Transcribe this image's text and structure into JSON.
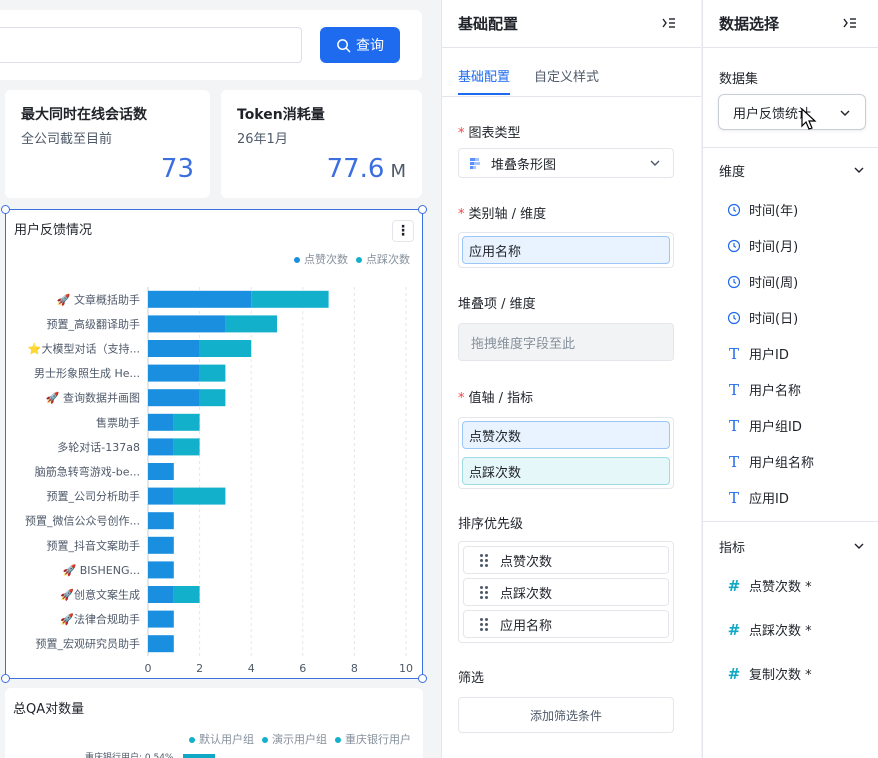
{
  "query": {
    "button_label": "查询",
    "input_value": ""
  },
  "metrics": [
    {
      "title": "最大同时在线会话数",
      "subtitle": "全公司截至目前",
      "value": "73",
      "unit": ""
    },
    {
      "title": "Token消耗量",
      "subtitle": "26年1月",
      "value": "77.6",
      "unit": "M"
    }
  ],
  "feedback_chart": {
    "title": "用户反馈情况",
    "more": "⋮",
    "legend": [
      "点赞次数",
      "点踩次数"
    ]
  },
  "chart_data": {
    "type": "bar",
    "orientation": "horizontal",
    "stacked": true,
    "categories": [
      "🚀 文章概括助手",
      "预置_高级翻译助手",
      "⭐大模型对话（支持...",
      "男士形象照生成 He...",
      "🚀 查询数据并画图",
      "售票助手",
      "多轮对话-137a8",
      "脑筋急转弯游戏-be...",
      "预置_公司分析助手",
      "预置_微信公众号创作...",
      "预置_抖音文案助手",
      "🚀 BISHENG...",
      "🚀创意文案生成",
      "🚀法律合规助手",
      "预置_宏观研究员助手"
    ],
    "series": [
      {
        "name": "点赞次数",
        "color": "#1a8fe0",
        "values": [
          4,
          3,
          2,
          2,
          2,
          1,
          1,
          1,
          1,
          1,
          1,
          1,
          1,
          1,
          1
        ]
      },
      {
        "name": "点踩次数",
        "color": "#13b0cc",
        "values": [
          3,
          2,
          2,
          1,
          1,
          1,
          1,
          0,
          2,
          0,
          0,
          0,
          1,
          0,
          0
        ]
      }
    ],
    "xlim": [
      0,
      10
    ],
    "xticks": [
      0,
      2,
      4,
      6,
      8,
      10
    ],
    "grid": true,
    "legend_position": "top-right"
  },
  "qa_chart": {
    "title": "总QA对数量",
    "legend": [
      {
        "label": "默认用户组",
        "color": "#13b0cc"
      },
      {
        "label": "演示用户组",
        "color": "#13b0cc"
      },
      {
        "label": "重庆银行用户",
        "color": "#13b0cc"
      }
    ],
    "peek_label": "重庆银行用户: 0.54%"
  },
  "config_panel": {
    "title": "基础配置",
    "tabs": [
      "基础配置",
      "自定义样式"
    ],
    "chart_type_label": "图表类型",
    "chart_type_value": "堆叠条形图",
    "category_axis_label": "类别轴 / 维度",
    "category_axis_value": "应用名称",
    "stack_label": "堆叠项 / 维度",
    "stack_placeholder": "拖拽维度字段至此",
    "value_axis_label": "值轴 / 指标",
    "value_axis_items": [
      "点赞次数",
      "点踩次数"
    ],
    "sort_label": "排序优先级",
    "sort_items": [
      "点赞次数",
      "点踩次数",
      "应用名称"
    ],
    "filter_label": "筛选",
    "add_filter": "添加筛选条件"
  },
  "data_panel": {
    "title": "数据选择",
    "dataset_label": "数据集",
    "dataset_value": "用户反馈统计",
    "dimension_label": "维度",
    "dimensions": [
      {
        "label": "时间(年)",
        "icon": "clock-icon"
      },
      {
        "label": "时间(月)",
        "icon": "clock-icon"
      },
      {
        "label": "时间(周)",
        "icon": "clock-icon"
      },
      {
        "label": "时间(日)",
        "icon": "clock-icon"
      },
      {
        "label": "用户ID",
        "icon": "text-type-icon"
      },
      {
        "label": "用户名称",
        "icon": "text-type-icon"
      },
      {
        "label": "用户组ID",
        "icon": "text-type-icon"
      },
      {
        "label": "用户组名称",
        "icon": "text-type-icon"
      },
      {
        "label": "应用ID",
        "icon": "text-type-icon"
      }
    ],
    "metric_label": "指标",
    "metrics": [
      "点赞次数 *",
      "点踩次数 *",
      "复制次数 *"
    ]
  }
}
